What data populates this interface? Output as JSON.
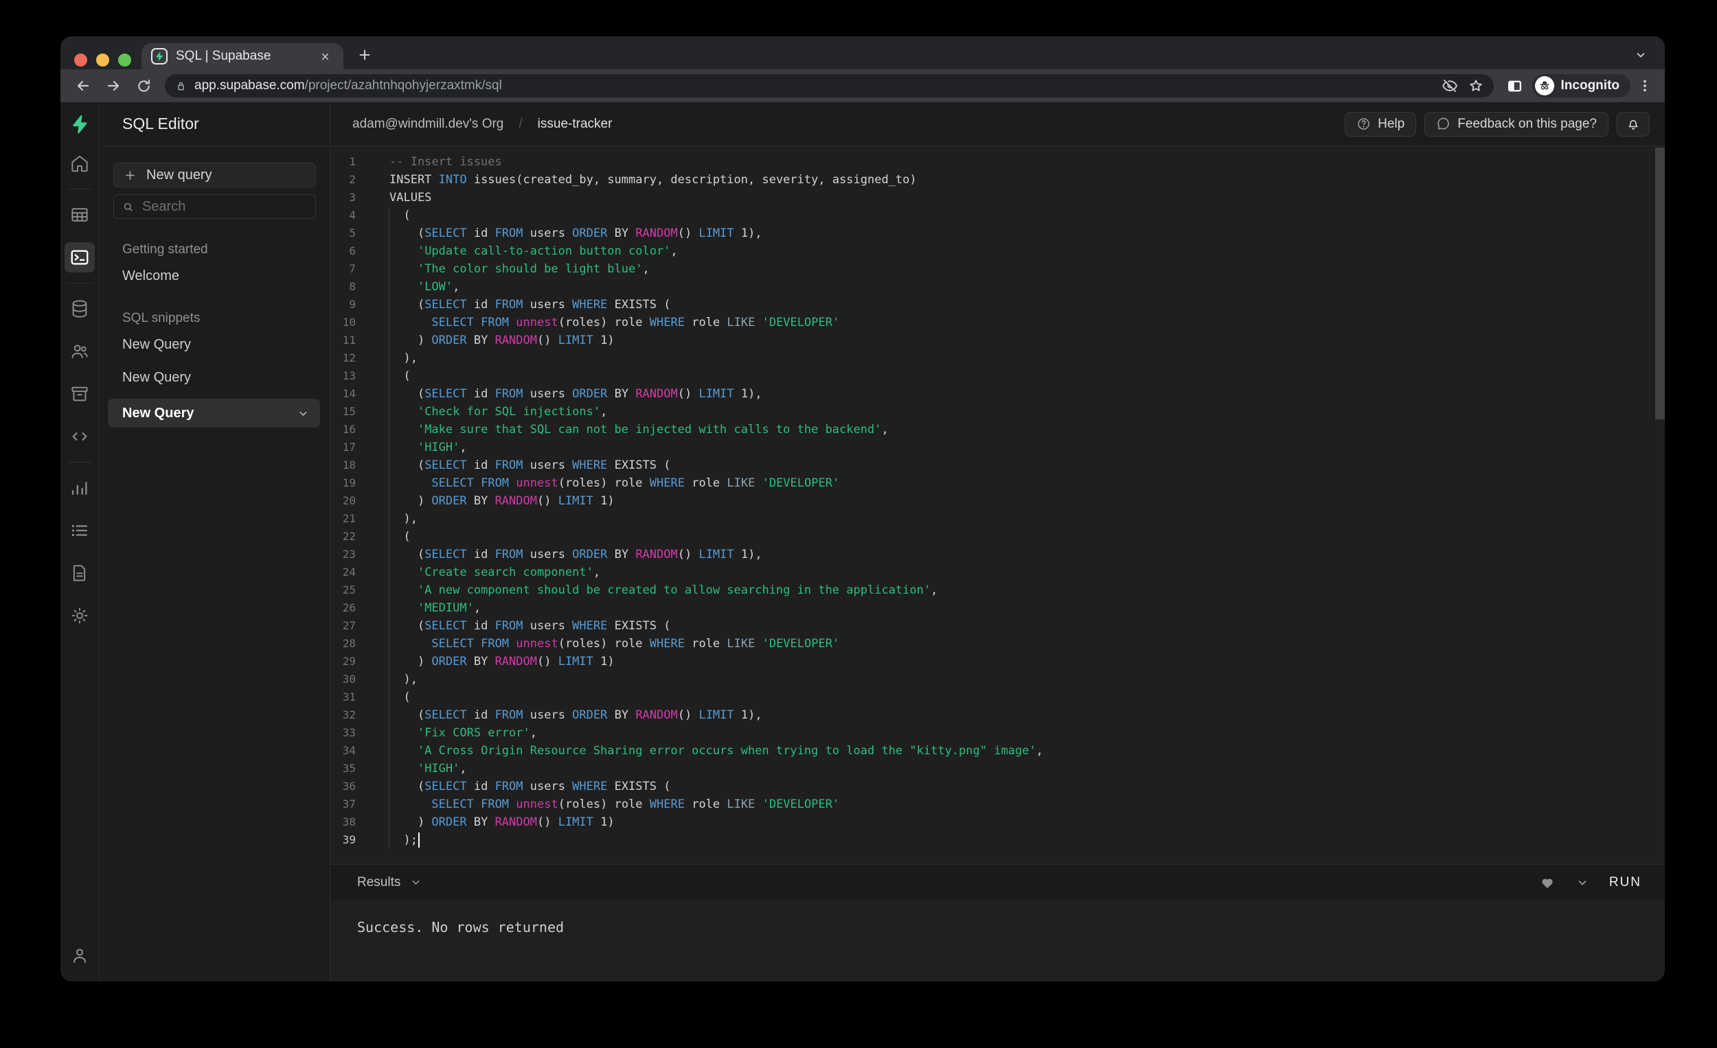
{
  "browser": {
    "tab_title": "SQL | Supabase",
    "url_host": "app.supabase.com",
    "url_path": "/project/azahtnhqohyjerzaxtmk/sql",
    "incognito_label": "Incognito"
  },
  "sidebar": {
    "title": "SQL Editor",
    "new_query_button": "New query",
    "search_placeholder": "Search",
    "sections": [
      {
        "label": "Getting started",
        "items": [
          {
            "label": "Welcome",
            "active": false
          }
        ]
      },
      {
        "label": "SQL snippets",
        "items": [
          {
            "label": "New Query",
            "active": false
          },
          {
            "label": "New Query",
            "active": false
          },
          {
            "label": "New Query",
            "active": true
          }
        ]
      }
    ]
  },
  "header": {
    "breadcrumb_org": "adam@windmill.dev's Org",
    "breadcrumb_separator": "/",
    "breadcrumb_project": "issue-tracker",
    "help_label": "Help",
    "feedback_label": "Feedback on this page?"
  },
  "editor": {
    "active_line": 39,
    "cursor_line": 39,
    "lines": [
      [
        [
          "c",
          "-- Insert issues"
        ]
      ],
      [
        [
          "t",
          "INSERT "
        ],
        [
          "k",
          "INTO"
        ],
        [
          "t",
          " issues(created_by, summary, description, severity, assigned_to)"
        ]
      ],
      [
        [
          "t",
          "VALUES"
        ]
      ],
      [
        [
          "t",
          "  ("
        ]
      ],
      [
        [
          "t",
          "    ("
        ],
        [
          "k",
          "SELECT"
        ],
        [
          "t",
          " id "
        ],
        [
          "k",
          "FROM"
        ],
        [
          "t",
          " users "
        ],
        [
          "k",
          "ORDER"
        ],
        [
          "t",
          " BY "
        ],
        [
          "f",
          "RANDOM"
        ],
        [
          "t",
          "() "
        ],
        [
          "k",
          "LIMIT"
        ],
        [
          "t",
          " 1),"
        ]
      ],
      [
        [
          "t",
          "    "
        ],
        [
          "s",
          "'Update call-to-action button color'"
        ],
        [
          "t",
          ","
        ]
      ],
      [
        [
          "t",
          "    "
        ],
        [
          "s",
          "'The color should be light blue'"
        ],
        [
          "t",
          ","
        ]
      ],
      [
        [
          "t",
          "    "
        ],
        [
          "s",
          "'LOW'"
        ],
        [
          "t",
          ","
        ]
      ],
      [
        [
          "t",
          "    ("
        ],
        [
          "k",
          "SELECT"
        ],
        [
          "t",
          " id "
        ],
        [
          "k",
          "FROM"
        ],
        [
          "t",
          " users "
        ],
        [
          "k",
          "WHERE"
        ],
        [
          "t",
          " EXISTS ("
        ]
      ],
      [
        [
          "t",
          "      "
        ],
        [
          "k",
          "SELECT"
        ],
        [
          "t",
          " "
        ],
        [
          "k",
          "FROM"
        ],
        [
          "t",
          " "
        ],
        [
          "f",
          "unnest"
        ],
        [
          "t",
          "(roles) role "
        ],
        [
          "k",
          "WHERE"
        ],
        [
          "t",
          " role "
        ],
        [
          "o",
          "LIKE"
        ],
        [
          "t",
          " "
        ],
        [
          "s",
          "'DEVELOPER'"
        ]
      ],
      [
        [
          "t",
          "    ) "
        ],
        [
          "k",
          "ORDER"
        ],
        [
          "t",
          " BY "
        ],
        [
          "f",
          "RANDOM"
        ],
        [
          "t",
          "() "
        ],
        [
          "k",
          "LIMIT"
        ],
        [
          "t",
          " 1)"
        ]
      ],
      [
        [
          "t",
          "  ),"
        ]
      ],
      [
        [
          "t",
          "  ("
        ]
      ],
      [
        [
          "t",
          "    ("
        ],
        [
          "k",
          "SELECT"
        ],
        [
          "t",
          " id "
        ],
        [
          "k",
          "FROM"
        ],
        [
          "t",
          " users "
        ],
        [
          "k",
          "ORDER"
        ],
        [
          "t",
          " BY "
        ],
        [
          "f",
          "RANDOM"
        ],
        [
          "t",
          "() "
        ],
        [
          "k",
          "LIMIT"
        ],
        [
          "t",
          " 1),"
        ]
      ],
      [
        [
          "t",
          "    "
        ],
        [
          "s",
          "'Check for SQL injections'"
        ],
        [
          "t",
          ","
        ]
      ],
      [
        [
          "t",
          "    "
        ],
        [
          "s",
          "'Make sure that SQL can not be injected with calls to the backend'"
        ],
        [
          "t",
          ","
        ]
      ],
      [
        [
          "t",
          "    "
        ],
        [
          "s",
          "'HIGH'"
        ],
        [
          "t",
          ","
        ]
      ],
      [
        [
          "t",
          "    ("
        ],
        [
          "k",
          "SELECT"
        ],
        [
          "t",
          " id "
        ],
        [
          "k",
          "FROM"
        ],
        [
          "t",
          " users "
        ],
        [
          "k",
          "WHERE"
        ],
        [
          "t",
          " EXISTS ("
        ]
      ],
      [
        [
          "t",
          "      "
        ],
        [
          "k",
          "SELECT"
        ],
        [
          "t",
          " "
        ],
        [
          "k",
          "FROM"
        ],
        [
          "t",
          " "
        ],
        [
          "f",
          "unnest"
        ],
        [
          "t",
          "(roles) role "
        ],
        [
          "k",
          "WHERE"
        ],
        [
          "t",
          " role "
        ],
        [
          "o",
          "LIKE"
        ],
        [
          "t",
          " "
        ],
        [
          "s",
          "'DEVELOPER'"
        ]
      ],
      [
        [
          "t",
          "    ) "
        ],
        [
          "k",
          "ORDER"
        ],
        [
          "t",
          " BY "
        ],
        [
          "f",
          "RANDOM"
        ],
        [
          "t",
          "() "
        ],
        [
          "k",
          "LIMIT"
        ],
        [
          "t",
          " 1)"
        ]
      ],
      [
        [
          "t",
          "  ),"
        ]
      ],
      [
        [
          "t",
          "  ("
        ]
      ],
      [
        [
          "t",
          "    ("
        ],
        [
          "k",
          "SELECT"
        ],
        [
          "t",
          " id "
        ],
        [
          "k",
          "FROM"
        ],
        [
          "t",
          " users "
        ],
        [
          "k",
          "ORDER"
        ],
        [
          "t",
          " BY "
        ],
        [
          "f",
          "RANDOM"
        ],
        [
          "t",
          "() "
        ],
        [
          "k",
          "LIMIT"
        ],
        [
          "t",
          " 1),"
        ]
      ],
      [
        [
          "t",
          "    "
        ],
        [
          "s",
          "'Create search component'"
        ],
        [
          "t",
          ","
        ]
      ],
      [
        [
          "t",
          "    "
        ],
        [
          "s",
          "'A new component should be created to allow searching in the application'"
        ],
        [
          "t",
          ","
        ]
      ],
      [
        [
          "t",
          "    "
        ],
        [
          "s",
          "'MEDIUM'"
        ],
        [
          "t",
          ","
        ]
      ],
      [
        [
          "t",
          "    ("
        ],
        [
          "k",
          "SELECT"
        ],
        [
          "t",
          " id "
        ],
        [
          "k",
          "FROM"
        ],
        [
          "t",
          " users "
        ],
        [
          "k",
          "WHERE"
        ],
        [
          "t",
          " EXISTS ("
        ]
      ],
      [
        [
          "t",
          "      "
        ],
        [
          "k",
          "SELECT"
        ],
        [
          "t",
          " "
        ],
        [
          "k",
          "FROM"
        ],
        [
          "t",
          " "
        ],
        [
          "f",
          "unnest"
        ],
        [
          "t",
          "(roles) role "
        ],
        [
          "k",
          "WHERE"
        ],
        [
          "t",
          " role "
        ],
        [
          "o",
          "LIKE"
        ],
        [
          "t",
          " "
        ],
        [
          "s",
          "'DEVELOPER'"
        ]
      ],
      [
        [
          "t",
          "    ) "
        ],
        [
          "k",
          "ORDER"
        ],
        [
          "t",
          " BY "
        ],
        [
          "f",
          "RANDOM"
        ],
        [
          "t",
          "() "
        ],
        [
          "k",
          "LIMIT"
        ],
        [
          "t",
          " 1)"
        ]
      ],
      [
        [
          "t",
          "  ),"
        ]
      ],
      [
        [
          "t",
          "  ("
        ]
      ],
      [
        [
          "t",
          "    ("
        ],
        [
          "k",
          "SELECT"
        ],
        [
          "t",
          " id "
        ],
        [
          "k",
          "FROM"
        ],
        [
          "t",
          " users "
        ],
        [
          "k",
          "ORDER"
        ],
        [
          "t",
          " BY "
        ],
        [
          "f",
          "RANDOM"
        ],
        [
          "t",
          "() "
        ],
        [
          "k",
          "LIMIT"
        ],
        [
          "t",
          " 1),"
        ]
      ],
      [
        [
          "t",
          "    "
        ],
        [
          "s",
          "'Fix CORS error'"
        ],
        [
          "t",
          ","
        ]
      ],
      [
        [
          "t",
          "    "
        ],
        [
          "s",
          "'A Cross Origin Resource Sharing error occurs when trying to load the \"kitty.png\" image'"
        ],
        [
          "t",
          ","
        ]
      ],
      [
        [
          "t",
          "    "
        ],
        [
          "s",
          "'HIGH'"
        ],
        [
          "t",
          ","
        ]
      ],
      [
        [
          "t",
          "    ("
        ],
        [
          "k",
          "SELECT"
        ],
        [
          "t",
          " id "
        ],
        [
          "k",
          "FROM"
        ],
        [
          "t",
          " users "
        ],
        [
          "k",
          "WHERE"
        ],
        [
          "t",
          " EXISTS ("
        ]
      ],
      [
        [
          "t",
          "      "
        ],
        [
          "k",
          "SELECT"
        ],
        [
          "t",
          " "
        ],
        [
          "k",
          "FROM"
        ],
        [
          "t",
          " "
        ],
        [
          "f",
          "unnest"
        ],
        [
          "t",
          "(roles) role "
        ],
        [
          "k",
          "WHERE"
        ],
        [
          "t",
          " role "
        ],
        [
          "o",
          "LIKE"
        ],
        [
          "t",
          " "
        ],
        [
          "s",
          "'DEVELOPER'"
        ]
      ],
      [
        [
          "t",
          "    ) "
        ],
        [
          "k",
          "ORDER"
        ],
        [
          "t",
          " BY "
        ],
        [
          "f",
          "RANDOM"
        ],
        [
          "t",
          "() "
        ],
        [
          "k",
          "LIMIT"
        ],
        [
          "t",
          " 1)"
        ]
      ],
      [
        [
          "t",
          "  );"
        ]
      ]
    ]
  },
  "results": {
    "label": "Results",
    "run_label": "RUN",
    "message": "Success. No rows returned"
  },
  "colors": {
    "brand_green": "#3ecf8e",
    "keyword_blue": "#569cd6",
    "function_magenta": "#d13ba8",
    "string_green": "#2ebd7f",
    "editor_bg": "#1f1f1f"
  }
}
